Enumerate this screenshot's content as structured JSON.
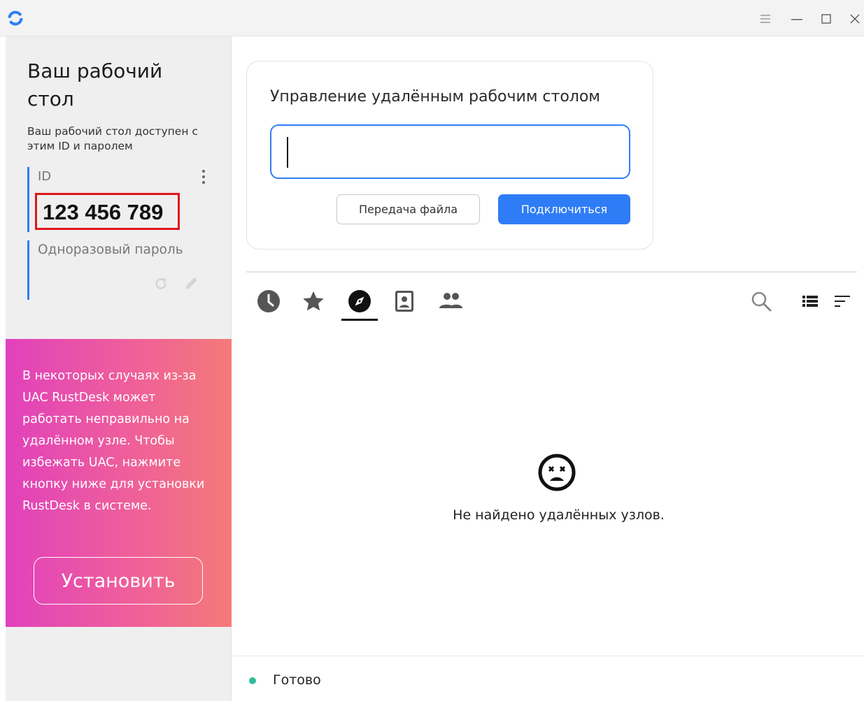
{
  "colors": {
    "accent": "#2f7df6",
    "highlight_box": "#e0161a",
    "promo_gradient_start": "#e141bc",
    "promo_gradient_end": "#f47a78",
    "status_ready": "#32bd9a"
  },
  "titlebar": {
    "icons": [
      "rustdesk-logo-icon",
      "menu-icon",
      "minimize-icon",
      "maximize-icon",
      "close-icon"
    ]
  },
  "sidebar": {
    "title": "Ваш рабочий стол",
    "description": "Ваш рабочий стол доступен с этим ID и паролем",
    "id_label": "ID",
    "id_value": "123 456 789",
    "password_label": "Одноразовый пароль",
    "password_value": "",
    "promo_text": "В некоторых случаях из-за UAC RustDesk может работать неправильно на удалённом узле. Чтобы избежать UAC, нажмите кнопку ниже для установки RustDesk в системе.",
    "install_button": "Установить"
  },
  "connect": {
    "title": "Управление удалённым рабочим столом",
    "input_value": "",
    "file_transfer_button": "Передача файла",
    "connect_button": "Подключиться"
  },
  "tabs": [
    {
      "icon": "clock-icon",
      "name": "recent"
    },
    {
      "icon": "star-icon",
      "name": "favorites"
    },
    {
      "icon": "compass-icon",
      "name": "discovered",
      "selected": true
    },
    {
      "icon": "address-book-icon",
      "name": "address-book"
    },
    {
      "icon": "group-icon",
      "name": "group"
    }
  ],
  "peers": {
    "empty_text": "Не найдено удалённых узлов."
  },
  "status": {
    "text": "Готово"
  }
}
